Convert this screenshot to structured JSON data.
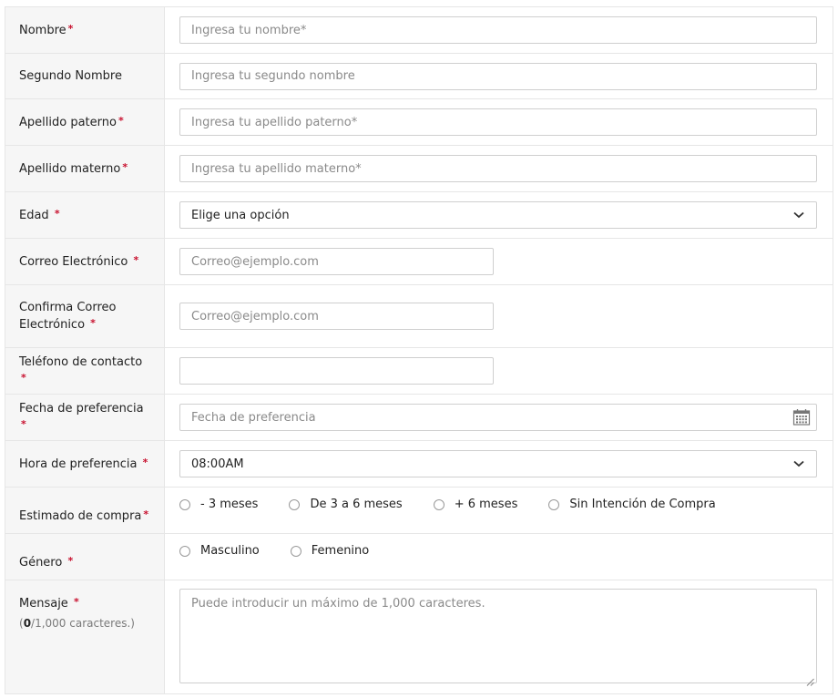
{
  "required_marker": "*",
  "fields": {
    "nombre": {
      "label": "Nombre",
      "placeholder": "Ingresa tu nombre*"
    },
    "segundo_nombre": {
      "label": "Segundo Nombre",
      "placeholder": "Ingresa tu segundo nombre"
    },
    "apellido_paterno": {
      "label": "Apellido paterno",
      "placeholder": "Ingresa tu apellido paterno*"
    },
    "apellido_materno": {
      "label": "Apellido materno",
      "placeholder": "Ingresa tu apellido materno*"
    },
    "edad": {
      "label": "Edad ",
      "value": "Elige una opción"
    },
    "correo": {
      "label": "Correo Electrónico ",
      "placeholder": "Correo@ejemplo.com"
    },
    "confirma_correo": {
      "label": "Confirma Correo Electrónico ",
      "placeholder": "Correo@ejemplo.com"
    },
    "telefono": {
      "label": "Teléfono de contacto ",
      "placeholder": ""
    },
    "fecha": {
      "label": "Fecha de preferencia ",
      "placeholder": "Fecha de preferencia"
    },
    "hora": {
      "label": "Hora de preferencia ",
      "value": "08:00AM"
    },
    "estimado": {
      "label": "Estimado de compra",
      "options": [
        "- 3 meses",
        "De 3 a 6 meses",
        "+ 6 meses",
        "Sin Intención de Compra"
      ]
    },
    "genero": {
      "label": "Género ",
      "options": [
        "Masculino",
        "Femenino"
      ]
    },
    "mensaje": {
      "label": "Mensaje ",
      "count": "0",
      "count_suffix": "/1,000 caracteres.)",
      "count_prefix": "(",
      "placeholder": "Puede introducir un máximo de 1,000 caracteres."
    }
  },
  "colors": {
    "required": "#c8102e",
    "label_bg": "#f6f6f6",
    "border": "#e6e6e6"
  },
  "icons": {
    "select": "chevron-down-icon",
    "date": "calendar-icon",
    "textarea": "resize-grip-icon"
  }
}
